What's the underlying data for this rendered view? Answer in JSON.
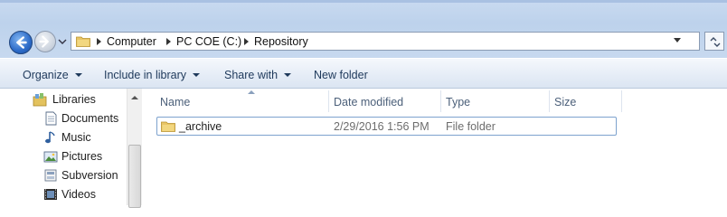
{
  "address_bar": {
    "crumbs": [
      "Computer",
      "PC COE (C:)",
      "Repository"
    ]
  },
  "command_bar": {
    "organize": "Organize",
    "include_in_library": "Include in library",
    "share_with": "Share with",
    "new_folder": "New folder"
  },
  "nav_pane": {
    "libraries": "Libraries",
    "items": [
      "Documents",
      "Music",
      "Pictures",
      "Subversion",
      "Videos"
    ]
  },
  "file_list": {
    "columns": {
      "name": "Name",
      "date_modified": "Date modified",
      "type": "Type",
      "size": "Size"
    },
    "rows": [
      {
        "name": "_archive",
        "date_modified": "2/29/2016 1:56 PM",
        "type": "File folder",
        "size": ""
      }
    ]
  },
  "colors": {
    "accent": "#2c6bc8",
    "folder": "#e8c566",
    "selection_border": "#7da2ce"
  }
}
